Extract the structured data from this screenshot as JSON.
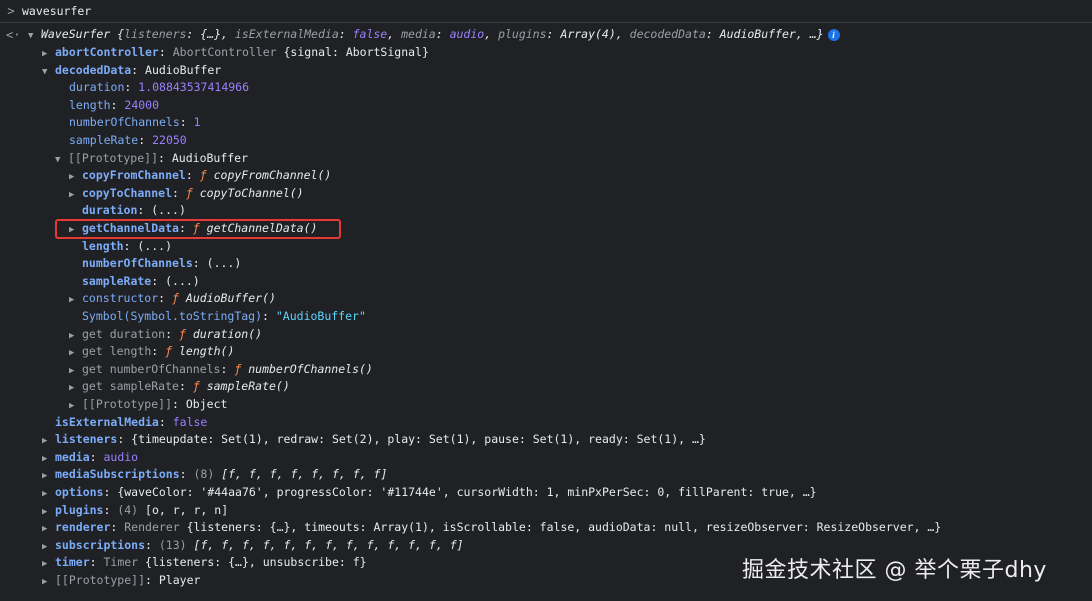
{
  "console": {
    "prompt_input": "wavesurfer",
    "highlight_color": "#e53935"
  },
  "summary": {
    "class_name": "WaveSurfer",
    "text_1": " {",
    "listeners_key": "listeners",
    "listeners_val": ": {…}, ",
    "ext_key": "isExternalMedia",
    "colon_sep": ": ",
    "ext_val": "false",
    "comma": ", ",
    "media_key": "media",
    "media_val": "audio",
    "plugins_key": "plugins",
    "plugins_val": "Array(4)",
    "decoded_key": "decodedData",
    "decoded_val": "AudioBuffer",
    "tail": ", …}",
    "info_glyph": "i"
  },
  "rows": {
    "abort": {
      "key": "abortController",
      "type": "AbortController",
      "rest": " {signal: AbortSignal}"
    },
    "decoded": {
      "key": "decodedData",
      "val": "AudioBuffer"
    },
    "duration": {
      "key": "duration",
      "val": "1.08843537414966"
    },
    "length": {
      "key": "length",
      "val": "24000"
    },
    "channels": {
      "key": "numberOfChannels",
      "val": "1"
    },
    "samplerate": {
      "key": "sampleRate",
      "val": "22050"
    },
    "proto": {
      "key": "[[Prototype]]",
      "val": "AudioBuffer"
    },
    "copyFrom": {
      "key": "copyFromChannel",
      "f": "ƒ",
      "sig": "copyFromChannel()"
    },
    "copyTo": {
      "key": "copyToChannel",
      "f": "ƒ",
      "sig": "copyToChannel()"
    },
    "pduration": {
      "key": "duration",
      "val": "(...)"
    },
    "getChannel": {
      "key": "getChannelData",
      "f": "ƒ",
      "sig": "getChannelData()"
    },
    "plength": {
      "key": "length",
      "val": "(...)"
    },
    "pchannels": {
      "key": "numberOfChannels",
      "val": "(...)"
    },
    "psample": {
      "key": "sampleRate",
      "val": "(...)"
    },
    "ctor": {
      "key": "constructor",
      "f": "ƒ",
      "sig": "AudioBuffer()"
    },
    "symtag": {
      "key": "Symbol(Symbol.toStringTag)",
      "val": "\"AudioBuffer\""
    },
    "gduration": {
      "pre": "get ",
      "key": "duration",
      "f": "ƒ",
      "sig": "duration()"
    },
    "glength": {
      "pre": "get ",
      "key": "length",
      "f": "ƒ",
      "sig": "length()"
    },
    "gchannels": {
      "pre": "get ",
      "key": "numberOfChannels",
      "f": "ƒ",
      "sig": "numberOfChannels()"
    },
    "gsample": {
      "pre": "get ",
      "key": "sampleRate",
      "f": "ƒ",
      "sig": "sampleRate()"
    },
    "proto2": {
      "key": "[[Prototype]]",
      "val": "Object"
    },
    "isExt": {
      "key": "isExternalMedia",
      "val": "false"
    },
    "listeners": {
      "key": "listeners",
      "val": "{timeupdate: Set(1), redraw: Set(2), play: Set(1), pause: Set(1), ready: Set(1), …}"
    },
    "media": {
      "key": "media",
      "val": "audio"
    },
    "mediaSubs": {
      "key": "mediaSubscriptions",
      "count": "(8)",
      "val": "[f, f, f, f, f, f, f, f]"
    },
    "options": {
      "key": "options",
      "val": "{waveColor: '#44aa76', progressColor: '#11744e', cursorWidth: 1, minPxPerSec: 0, fillParent: true, …}"
    },
    "plugins": {
      "key": "plugins",
      "count": "(4)",
      "val": "[o, r, r, n]"
    },
    "renderer": {
      "key": "renderer",
      "type": "Renderer",
      "val": " {listeners: {…}, timeouts: Array(1), isScrollable: false, audioData: null, resizeObserver: ResizeObserver, …}"
    },
    "subs": {
      "key": "subscriptions",
      "count": "(13)",
      "val": "[f, f, f, f, f, f, f, f, f, f, f, f, f]"
    },
    "timer": {
      "key": "timer",
      "type": "Timer",
      "val": " {listeners: {…}, unsubscribe: f}"
    },
    "proto3": {
      "key": "[[Prototype]]",
      "val": "Player"
    }
  },
  "watermark": "掘金技术社区 @ 举个栗子dhy"
}
